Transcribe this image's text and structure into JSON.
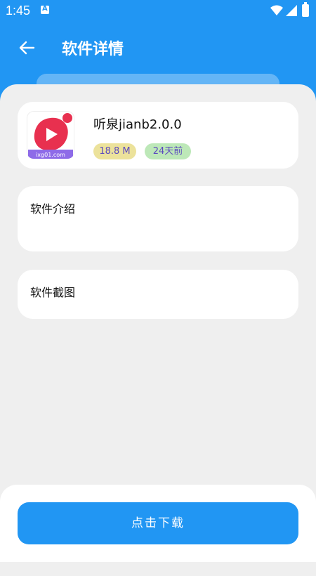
{
  "status_bar": {
    "time": "1:45",
    "icons": [
      "notification-icon",
      "wifi-icon",
      "signal-icon",
      "battery-icon"
    ]
  },
  "app_bar": {
    "back_icon": "arrow-left-icon",
    "title": "软件详情"
  },
  "app_info": {
    "name": "听泉jianb2.0.0",
    "icon": "play-logo-icon",
    "icon_caption": "ixg01.com",
    "size": "18.8 M",
    "updated": "24天前"
  },
  "sections": {
    "intro_label": "软件介绍",
    "screenshots_label": "软件截图"
  },
  "actions": {
    "download_label": "点击下载"
  },
  "colors": {
    "primary": "#2196F3",
    "sheet_background": "#EFEFEF",
    "size_badge": "#ECE29B",
    "date_badge": "#BDE8B8"
  }
}
